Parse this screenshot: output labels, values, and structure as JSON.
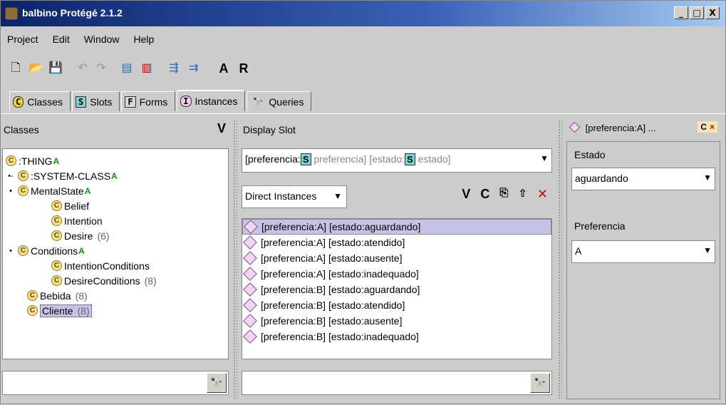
{
  "window": {
    "title": "balbino  Protégé 2.1.2",
    "min": "_",
    "max": "□",
    "close": "X"
  },
  "menubar": [
    "Project",
    "Edit",
    "Window",
    "Help"
  ],
  "toolbar": {
    "letter_a": "A",
    "letter_r": "R"
  },
  "tabs": [
    {
      "label": "Classes",
      "icon": "C"
    },
    {
      "label": "Slots",
      "icon": "S"
    },
    {
      "label": "Forms",
      "icon": "F"
    },
    {
      "label": "Instances",
      "icon": "I"
    },
    {
      "label": "Queries",
      "icon": "Q"
    }
  ],
  "classes_pane": {
    "header": "Classes",
    "v": "V",
    "tree": [
      {
        "name": ":THING",
        "count": "",
        "abstract": "A",
        "toggle": ""
      },
      {
        "name": ":SYSTEM-CLASS",
        "count": "",
        "abstract": "A",
        "toggle": "•-"
      },
      {
        "name": "MentalState",
        "count": "",
        "abstract": "A",
        "toggle": "•"
      },
      {
        "name": "Belief",
        "count": "",
        "abstract": "",
        "toggle": ""
      },
      {
        "name": "Intention",
        "count": "",
        "abstract": "",
        "toggle": ""
      },
      {
        "name": "Desire",
        "count": "(6)",
        "abstract": "",
        "toggle": ""
      },
      {
        "name": "Conditions",
        "count": "",
        "abstract": "A",
        "toggle": "•"
      },
      {
        "name": "IntentionConditions",
        "count": "",
        "abstract": "",
        "toggle": ""
      },
      {
        "name": "DesireConditions",
        "count": "(8)",
        "abstract": "",
        "toggle": ""
      },
      {
        "name": "Bebida",
        "count": "(8)",
        "abstract": "",
        "toggle": ""
      },
      {
        "name": "Cliente",
        "count": "(8)",
        "abstract": "",
        "toggle": ""
      }
    ]
  },
  "instances_pane": {
    "display_slot_label": "Display Slot",
    "slot_combo": {
      "p1": "[preferencia:",
      "s1": "S",
      "p2": "preferencia]",
      "p3": "[estado:",
      "s2": "S",
      "p4": "estado]"
    },
    "direct_instances": "Direct Instances",
    "icons": {
      "v": "V",
      "c": "C",
      "x": "✕"
    },
    "rows": [
      "[preferencia:A]  [estado:aguardando]",
      "[preferencia:A]  [estado:atendido]",
      "[preferencia:A]  [estado:ausente]",
      "[preferencia:A]  [estado:inadequado]",
      "[preferencia:B]  [estado:aguardando]",
      "[preferencia:B]  [estado:atendido]",
      "[preferencia:B]  [estado:ausente]",
      "[preferencia:B]  [estado:inadequado]"
    ]
  },
  "form_pane": {
    "title": "[preferencia:A] ...",
    "c": "C",
    "x": "×",
    "estado_label": "Estado",
    "estado_value": "aguardando",
    "preferencia_label": "Preferencia",
    "preferencia_value": "A"
  }
}
